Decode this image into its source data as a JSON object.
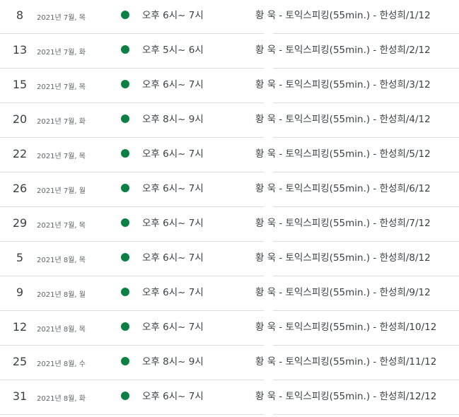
{
  "theme": {
    "event_dot_color": "#0b8043"
  },
  "agenda": {
    "events": [
      {
        "day": "8",
        "month_weekday": "2021년 7월, 목",
        "time": "오후 6시~ 7시",
        "title": "황  욱 - 토익스피킹(55min.) - 한성희/1/12"
      },
      {
        "day": "13",
        "month_weekday": "2021년 7월, 화",
        "time": "오후 5시~ 6시",
        "title": "황  욱 - 토익스피킹(55min.) - 한성희/2/12"
      },
      {
        "day": "15",
        "month_weekday": "2021년 7월, 목",
        "time": "오후 6시~ 7시",
        "title": "황  욱 - 토익스피킹(55min.) - 한성희/3/12"
      },
      {
        "day": "20",
        "month_weekday": "2021년 7월, 화",
        "time": "오후 8시~ 9시",
        "title": "황  욱 - 토익스피킹(55min.) - 한성희/4/12"
      },
      {
        "day": "22",
        "month_weekday": "2021년 7월, 목",
        "time": "오후 6시~ 7시",
        "title": "황  욱 - 토익스피킹(55min.) - 한성희/5/12"
      },
      {
        "day": "26",
        "month_weekday": "2021년 7월, 월",
        "time": "오후 6시~ 7시",
        "title": "황  욱 - 토익스피킹(55min.) - 한성희/6/12"
      },
      {
        "day": "29",
        "month_weekday": "2021년 7월, 목",
        "time": "오후 6시~ 7시",
        "title": "황  욱 - 토익스피킹(55min.) - 한성희/7/12"
      },
      {
        "day": "5",
        "month_weekday": "2021년 8월, 목",
        "time": "오후 6시~ 7시",
        "title": "황  욱 - 토익스피킹(55min.) - 한성희/8/12"
      },
      {
        "day": "9",
        "month_weekday": "2021년 8월, 월",
        "time": "오후 6시~ 7시",
        "title": "황  욱 - 토익스피킹(55min.) - 한성희/9/12"
      },
      {
        "day": "12",
        "month_weekday": "2021년 8월, 목",
        "time": "오후 6시~ 7시",
        "title": "황  욱 - 토익스피킹(55min.) - 한성희/10/12"
      },
      {
        "day": "25",
        "month_weekday": "2021년 8월, 수",
        "time": "오후 8시~ 9시",
        "title": "황  욱 - 토익스피킹(55min.) - 한성희/11/12"
      },
      {
        "day": "31",
        "month_weekday": "2021년 8월, 화",
        "time": "오후 6시~ 7시",
        "title": "황  욱 - 토익스피킹(55min.) - 한성희/12/12"
      }
    ]
  }
}
